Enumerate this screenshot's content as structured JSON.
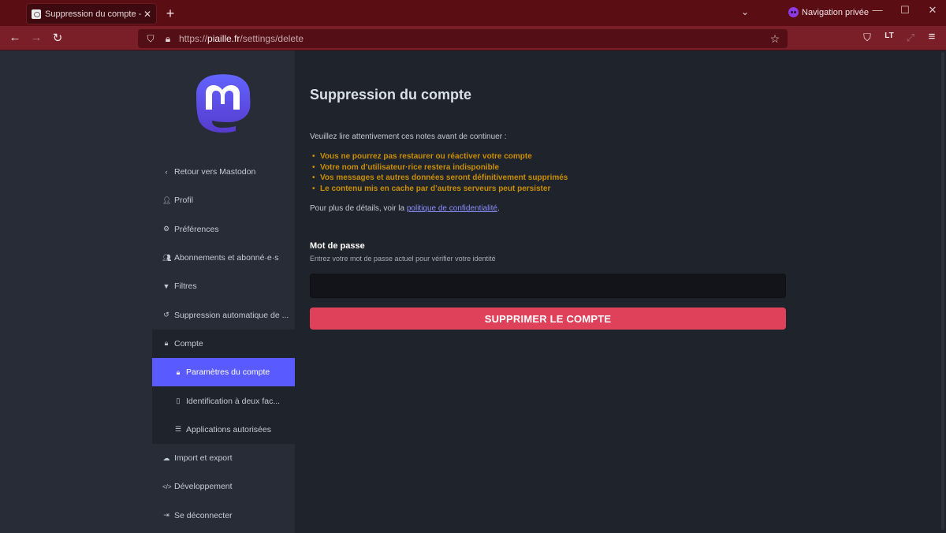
{
  "browser": {
    "tab": {
      "title": "Suppression du compte - Piaille",
      "favicon": "piaille-favicon"
    },
    "private_label": "Navigation privée",
    "url": {
      "scheme": "https://",
      "host": "piaille.fr",
      "path": "/settings/delete"
    },
    "icons": {
      "back": "←",
      "forward": "→",
      "reload": "↻",
      "shield": "⛉",
      "lock": "🔒︎",
      "star": "☆",
      "new_tab": "+",
      "tab_close": "✕",
      "tab_list": "⌄",
      "minimize": "—",
      "maximize": "☐",
      "close": "✕",
      "pocket": "⛉",
      "languagetool": "LT",
      "extension": "⤢",
      "menu": "≡"
    }
  },
  "sidebar": {
    "items": [
      {
        "label": "Retour vers Mastodon",
        "icon": "‹"
      },
      {
        "label": "Profil",
        "icon": "👤︎"
      },
      {
        "label": "Préférences",
        "icon": "⚙"
      },
      {
        "label": "Abonnements et abonné·e·s",
        "icon": "👥︎"
      },
      {
        "label": "Filtres",
        "icon": "▼"
      },
      {
        "label": "Suppression automatique de ...",
        "icon": "↺"
      },
      {
        "label": "Compte",
        "icon": "🔒︎"
      }
    ],
    "subitems": [
      {
        "label": "Paramètres du compte",
        "icon": "🔒︎",
        "active": true
      },
      {
        "label": "Identification à deux fac...",
        "icon": "▯"
      },
      {
        "label": "Applications autorisées",
        "icon": "☰"
      }
    ],
    "bottom_items": [
      {
        "label": "Import et export",
        "icon": "☁"
      },
      {
        "label": "Développement",
        "icon": "</>"
      },
      {
        "label": "Se déconnecter",
        "icon": "⇥"
      }
    ]
  },
  "main": {
    "title": "Suppression du compte",
    "intro": "Veuillez lire attentivement ces notes avant de continuer :",
    "warnings": [
      "Vous ne pourrez pas restaurer ou réactiver votre compte",
      "Votre nom d’utilisateur·rice restera indisponible",
      "Vos messages et autres données seront définitivement supprimés",
      "Le contenu mis en cache par d’autres serveurs peut persister"
    ],
    "more_prefix": "Pour plus de détails, voir la ",
    "more_link": "politique de confidentialité",
    "more_suffix": ".",
    "password_label": "Mot de passe",
    "password_hint": "Entrez votre mot de passe actuel pour vérifier votre identité",
    "password_value": "",
    "delete_button": "SUPPRIMER LE COMPTE"
  },
  "colors": {
    "accent": "#595aff",
    "danger": "#df405a",
    "warning": "#ca8f04",
    "link": "#8c8dff",
    "tabstrip": "#5b0d14",
    "navbar": "#7a1f28"
  }
}
